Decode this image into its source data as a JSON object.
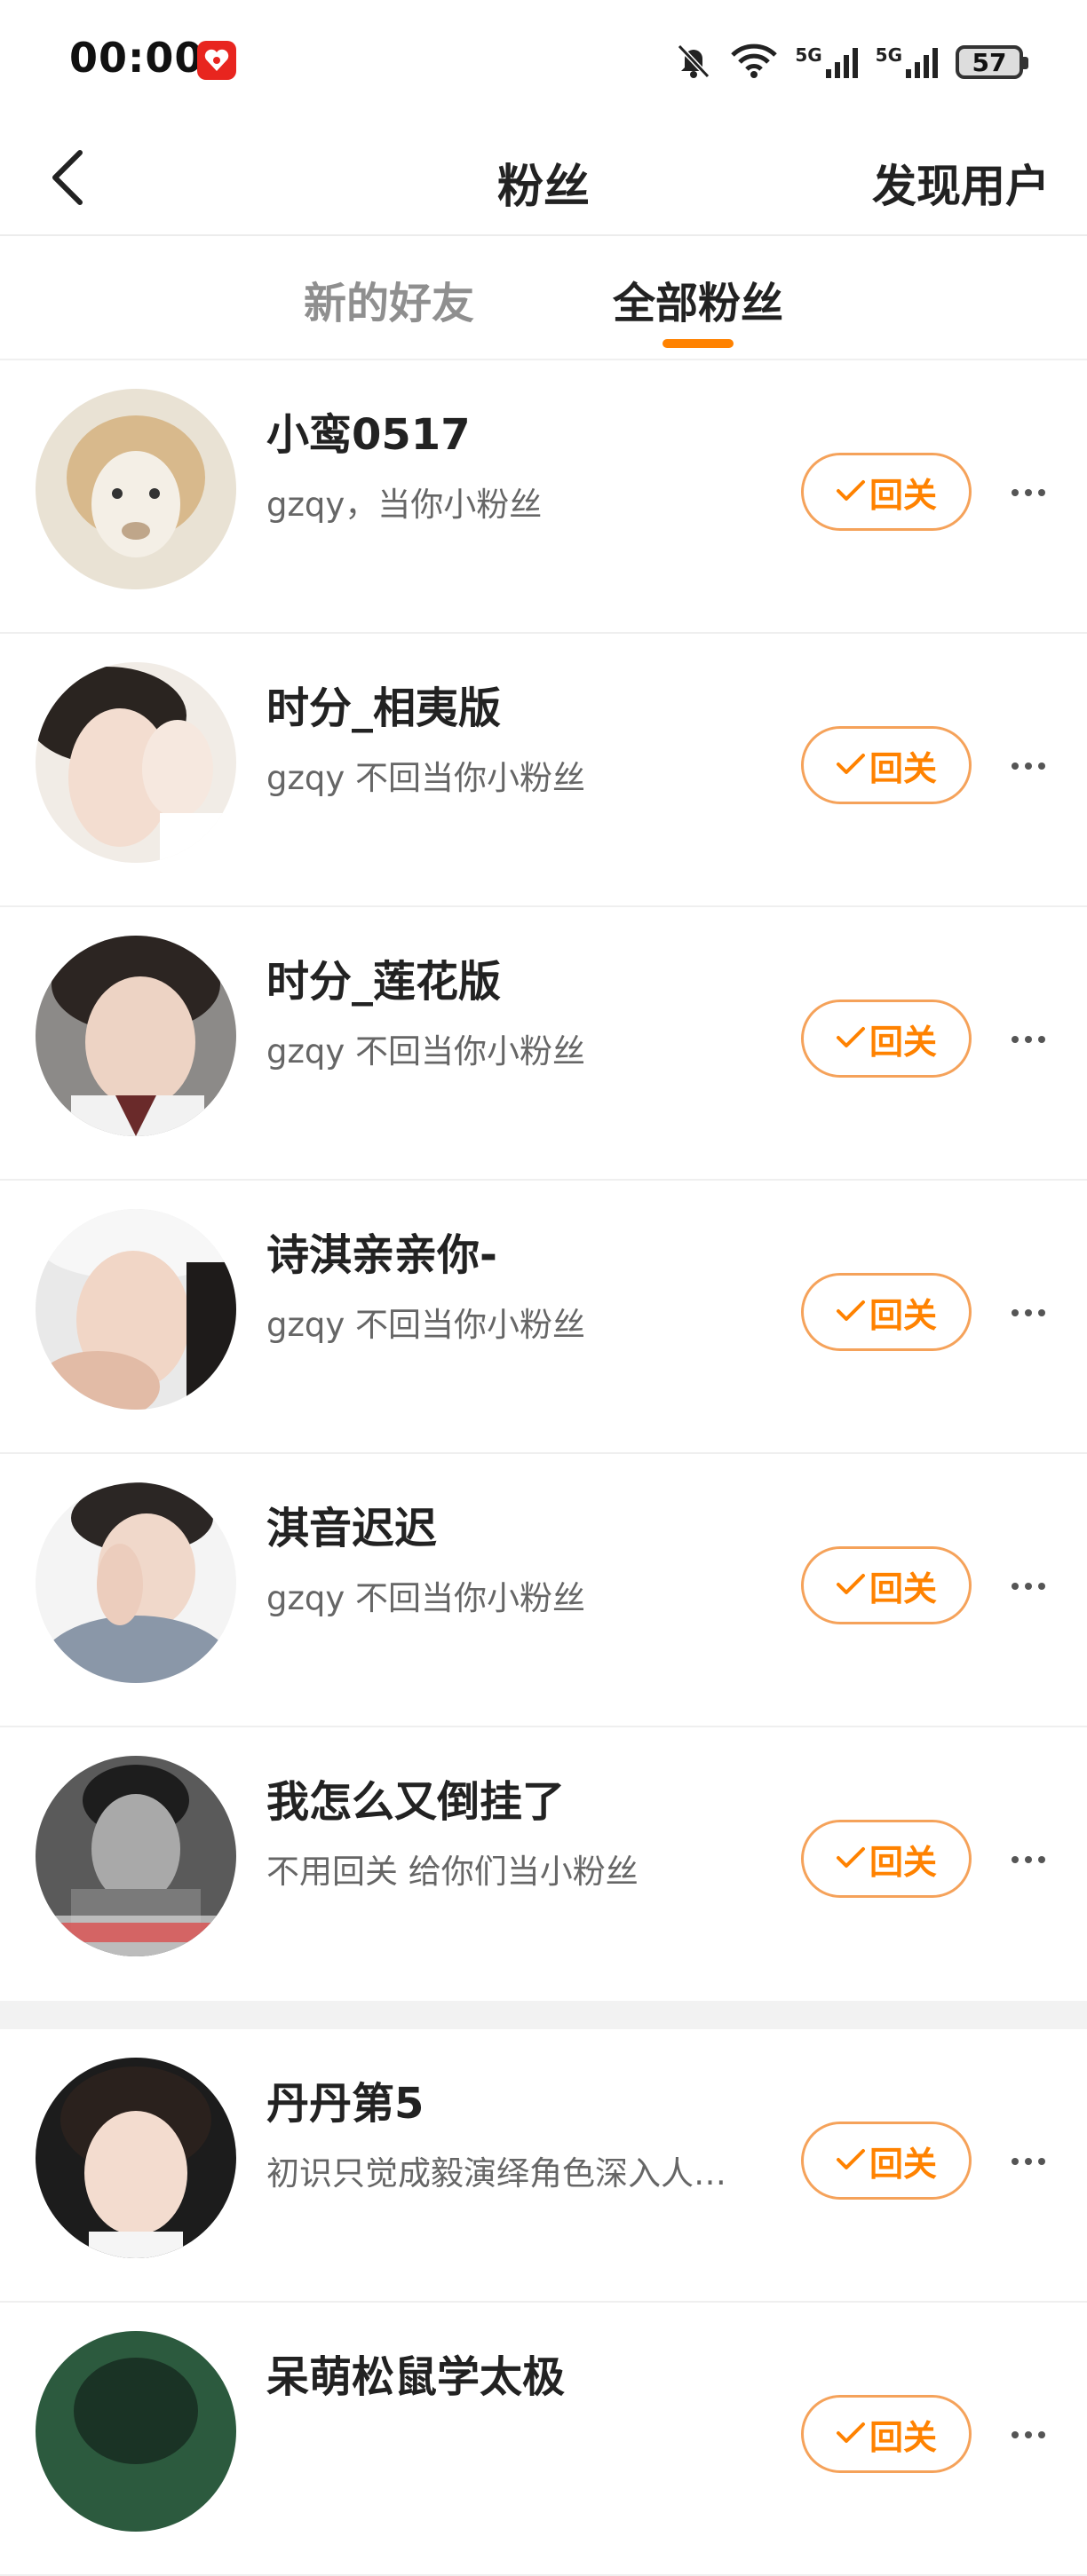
{
  "status_bar": {
    "time": "00:00",
    "network_1": "5G",
    "network_2": "5G",
    "battery": "57"
  },
  "header": {
    "title": "粉丝",
    "discover_label": "发现用户"
  },
  "tabs": [
    {
      "label": "新的好友",
      "active": false
    },
    {
      "label": "全部粉丝",
      "active": true
    }
  ],
  "accent_color": "#ff8200",
  "followers": [
    {
      "name": "小鸾0517",
      "desc": "gzqy，当你小粉丝",
      "button": "回关"
    },
    {
      "name": "时分_相夷版",
      "desc": "gzqy 不回当你小粉丝",
      "button": "回关"
    },
    {
      "name": "时分_莲花版",
      "desc": "gzqy 不回当你小粉丝",
      "button": "回关"
    },
    {
      "name": "诗淇亲亲你-",
      "desc": "gzqy 不回当你小粉丝",
      "button": "回关"
    },
    {
      "name": "淇音迟迟",
      "desc": "gzqy 不回当你小粉丝",
      "button": "回关"
    },
    {
      "name": "我怎么又倒挂了",
      "desc": "不用回关 给你们当小粉丝",
      "button": "回关"
    },
    {
      "name": "丹丹第5",
      "desc": "初识只觉成毅演绎角色深入人…",
      "button": "回关"
    },
    {
      "name": "呆萌松鼠学太极",
      "desc": "",
      "button": "回关"
    }
  ]
}
